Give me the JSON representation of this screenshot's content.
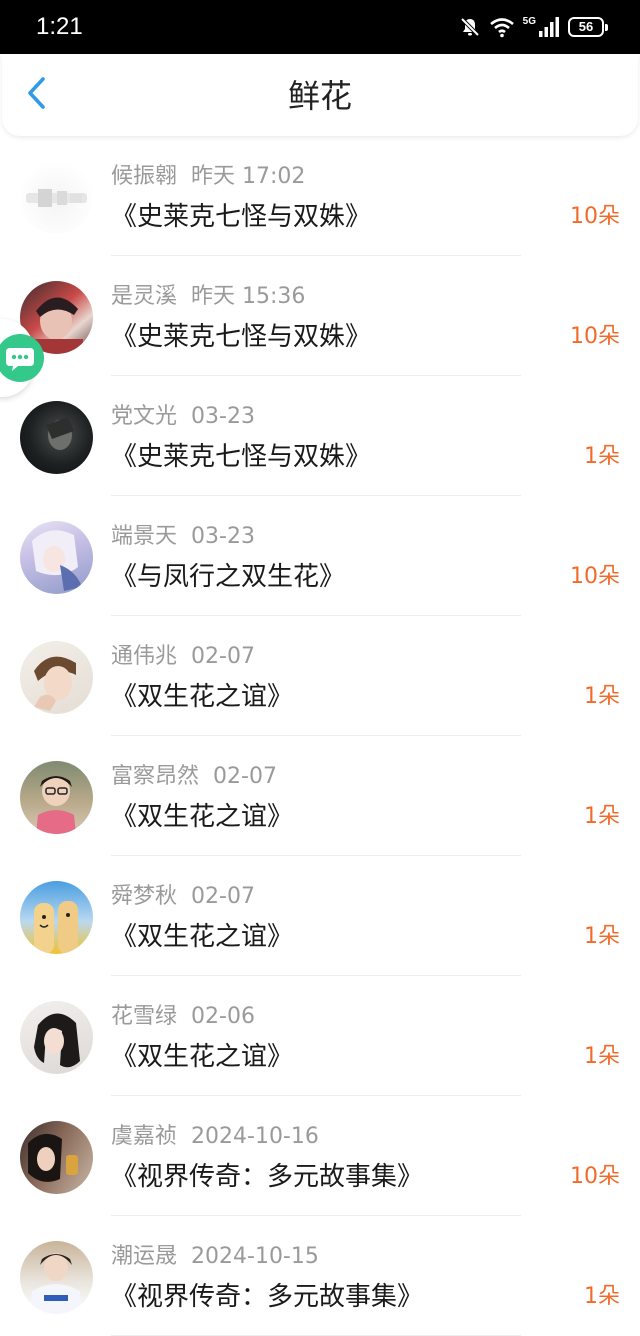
{
  "status_bar": {
    "time": "1:21",
    "network": "5G",
    "battery": "56"
  },
  "header": {
    "title": "鲜花",
    "back_icon": "chevron-left-icon"
  },
  "floating_button": {
    "icon": "chat-bubble-icon",
    "color": "#34c88a"
  },
  "colors": {
    "accent_blue": "#2f9be8",
    "count_orange": "#f06b2a",
    "meta_gray": "#9a9a9a"
  },
  "items": [
    {
      "name": "候振翱",
      "time": "昨天 17:02",
      "title": "《史莱克七怪与双姝》",
      "count": "10朵"
    },
    {
      "name": "是灵溪",
      "time": "昨天 15:36",
      "title": "《史莱克七怪与双姝》",
      "count": "10朵"
    },
    {
      "name": "党文光",
      "time": "03-23",
      "title": "《史莱克七怪与双姝》",
      "count": "1朵"
    },
    {
      "name": "端景天",
      "time": "03-23",
      "title": "《与凤行之双生花》",
      "count": "10朵"
    },
    {
      "name": "通伟兆",
      "time": "02-07",
      "title": "《双生花之谊》",
      "count": "1朵"
    },
    {
      "name": "富察昂然",
      "time": "02-07",
      "title": "《双生花之谊》",
      "count": "1朵"
    },
    {
      "name": "舜梦秋",
      "time": "02-07",
      "title": "《双生花之谊》",
      "count": "1朵"
    },
    {
      "name": "花雪绿",
      "time": "02-06",
      "title": "《双生花之谊》",
      "count": "1朵"
    },
    {
      "name": "虞嘉祯",
      "time": "2024-10-16",
      "title": "《视界传奇：多元故事集》",
      "count": "10朵"
    },
    {
      "name": "潮运晟",
      "time": "2024-10-15",
      "title": "《视界传奇：多元故事集》",
      "count": "1朵"
    }
  ]
}
